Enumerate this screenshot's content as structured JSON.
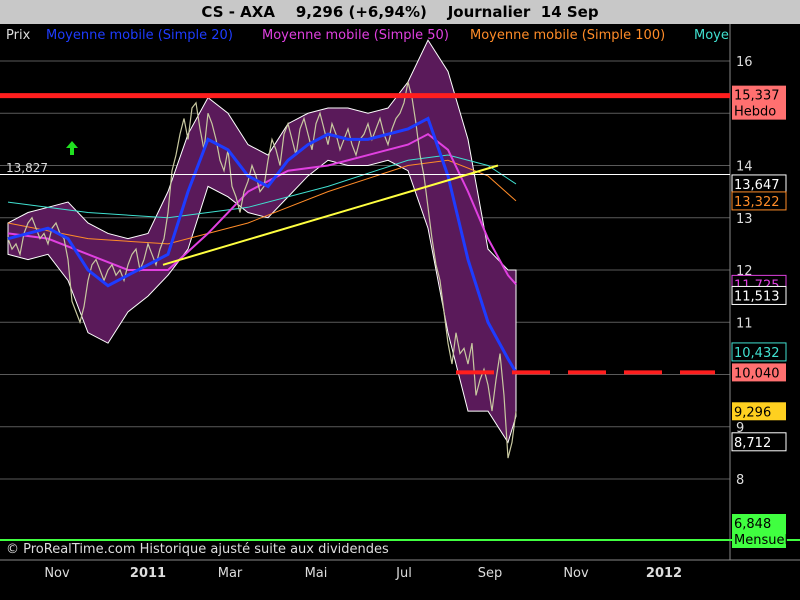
{
  "header": {
    "title": "CS - AXA    9,296 (+6,94%)    Journalier  14 Sep"
  },
  "colors": {
    "background": "#000000",
    "grid": "#5a5a5a",
    "price": "#c8c8a0",
    "envelope": "#5a1a5a",
    "ma20": "#1e3cff",
    "ma50": "#e040e0",
    "ma100": "#ff8c28",
    "ma200": "#40e0d0",
    "resistance": "#ff1e1e",
    "support_dashed": "#ff1e1e",
    "trendline": "#ffff40",
    "monthly_line": "#40ff40",
    "arrow": "#20e020"
  },
  "chart_data": {
    "type": "line",
    "title": "CS - AXA    9,296 (+6,94%)    Journalier  14 Sep",
    "legend": [
      "Prix",
      "Moyenne mobile (Simple 20)",
      "Moyenne mobile (Simple 50)",
      "Moyenne mobile (Simple 100)",
      "Moye"
    ],
    "legend_placement": "top",
    "y_ticks": [
      "16",
      "15",
      "14",
      "13",
      "12",
      "11",
      "10",
      "9",
      "8"
    ],
    "ylim": [
      6.6,
      16.5
    ],
    "x_ticks": [
      "Nov",
      "2011",
      "Mar",
      "Mai",
      "Jul",
      "Sep",
      "Nov",
      "2012"
    ],
    "grid": true,
    "series": [
      {
        "name": "Prix",
        "x": [
          0,
          4,
          8,
          12,
          16,
          20,
          24,
          28,
          32,
          36,
          40,
          44,
          48,
          52,
          56,
          60,
          64,
          68,
          72,
          76,
          80,
          84,
          88,
          92,
          96,
          100,
          104,
          108,
          112,
          116,
          120,
          124,
          128,
          132,
          136,
          140,
          144,
          148,
          152,
          156,
          160,
          164,
          168,
          172,
          176,
          180,
          184,
          188,
          192,
          196,
          200,
          204,
          208,
          212,
          216,
          220,
          224,
          228,
          232,
          236,
          240,
          244,
          248,
          252,
          256,
          260,
          264,
          268,
          272,
          276,
          280,
          284,
          288,
          292,
          296,
          300,
          304,
          308,
          312,
          316,
          320,
          324,
          328,
          332,
          336,
          340,
          344,
          348,
          352,
          356,
          360,
          364,
          368,
          372,
          376,
          380,
          384,
          388,
          392,
          396,
          400,
          404,
          408,
          412,
          416,
          420,
          424,
          428,
          432,
          436,
          440,
          444,
          448,
          452,
          456,
          460,
          464,
          468,
          472,
          476,
          480,
          484,
          488,
          492,
          496,
          500,
          504,
          508
        ],
        "y": [
          12.6,
          12.4,
          12.5,
          12.3,
          12.7,
          12.9,
          13.0,
          12.8,
          12.6,
          12.7,
          12.5,
          12.8,
          12.9,
          12.7,
          12.6,
          12.2,
          11.4,
          11.2,
          11.0,
          11.3,
          11.8,
          12.1,
          12.2,
          12.0,
          11.8,
          12.0,
          12.1,
          11.9,
          12.0,
          11.8,
          12.1,
          12.3,
          12.4,
          12.0,
          12.2,
          12.5,
          12.3,
          12.1,
          12.4,
          12.6,
          13.1,
          13.9,
          14.2,
          14.6,
          14.9,
          14.5,
          15.1,
          15.2,
          14.7,
          14.3,
          15.0,
          14.8,
          14.5,
          14.1,
          13.9,
          14.3,
          13.6,
          13.4,
          13.1,
          13.5,
          13.7,
          14.0,
          13.8,
          13.5,
          13.6,
          14.1,
          14.5,
          14.3,
          14.0,
          14.6,
          14.8,
          14.5,
          14.2,
          14.7,
          14.9,
          14.6,
          14.3,
          14.8,
          15.0,
          14.7,
          14.4,
          14.8,
          14.6,
          14.3,
          14.5,
          14.7,
          14.4,
          14.2,
          14.5,
          14.6,
          14.8,
          14.5,
          14.7,
          14.9,
          14.6,
          14.4,
          14.7,
          14.9,
          15.0,
          15.2,
          15.6,
          15.3,
          14.8,
          14.2,
          13.8,
          13.2,
          12.6,
          12.1,
          11.8,
          11.2,
          10.6,
          10.2,
          10.8,
          10.4,
          10.5,
          10.2,
          10.6,
          9.6,
          9.9,
          10.1,
          9.8,
          9.3,
          9.9,
          10.4,
          9.6,
          8.4,
          8.7,
          9.296
        ]
      },
      {
        "name": "Moyenne mobile (Simple 20)",
        "x": [
          0,
          20,
          40,
          60,
          80,
          100,
          120,
          140,
          160,
          180,
          200,
          220,
          240,
          260,
          280,
          300,
          320,
          340,
          360,
          380,
          400,
          420,
          440,
          460,
          480,
          500,
          508
        ],
        "y": [
          12.6,
          12.7,
          12.8,
          12.6,
          12.0,
          11.7,
          11.9,
          12.1,
          12.3,
          13.5,
          14.5,
          14.3,
          13.8,
          13.6,
          14.1,
          14.4,
          14.6,
          14.5,
          14.5,
          14.6,
          14.7,
          14.9,
          13.8,
          12.2,
          11.0,
          10.3,
          10.04
        ]
      },
      {
        "name": "Moyenne mobile (Simple 50)",
        "x": [
          0,
          40,
          80,
          120,
          160,
          200,
          220,
          240,
          280,
          320,
          360,
          400,
          420,
          440,
          460,
          480,
          500,
          508
        ],
        "y": [
          12.7,
          12.6,
          12.3,
          12.0,
          12.0,
          12.7,
          13.1,
          13.5,
          13.9,
          14.0,
          14.2,
          14.4,
          14.6,
          14.3,
          13.5,
          12.6,
          11.9,
          11.725
        ]
      },
      {
        "name": "Moyenne mobile (Simple 100)",
        "x": [
          0,
          80,
          160,
          240,
          320,
          400,
          440,
          480,
          508
        ],
        "y": [
          12.9,
          12.6,
          12.5,
          12.9,
          13.5,
          14.0,
          14.1,
          13.8,
          13.322
        ]
      },
      {
        "name": "Moye",
        "x": [
          0,
          80,
          160,
          240,
          320,
          400,
          440,
          480,
          508
        ],
        "y": [
          13.3,
          13.1,
          13.0,
          13.2,
          13.6,
          14.1,
          14.2,
          14.0,
          13.647
        ]
      }
    ],
    "envelope": {
      "x": [
        0,
        20,
        40,
        60,
        80,
        100,
        120,
        140,
        160,
        180,
        200,
        220,
        240,
        260,
        280,
        300,
        320,
        340,
        360,
        380,
        400,
        420,
        440,
        460,
        480,
        500,
        508
      ],
      "upper": [
        12.9,
        13.1,
        13.2,
        13.3,
        12.9,
        12.7,
        12.6,
        12.7,
        13.5,
        14.6,
        15.3,
        15.0,
        14.4,
        14.2,
        14.8,
        15.0,
        15.1,
        15.1,
        15.0,
        15.1,
        15.6,
        16.4,
        15.8,
        14.5,
        12.4,
        12.0,
        12.0
      ],
      "lower": [
        12.3,
        12.2,
        12.3,
        11.8,
        10.8,
        10.6,
        11.2,
        11.5,
        11.9,
        12.4,
        13.6,
        13.4,
        13.1,
        13.0,
        13.4,
        13.8,
        14.1,
        14.0,
        14.0,
        14.1,
        13.9,
        12.8,
        10.8,
        9.3,
        9.3,
        8.7,
        9.2
      ]
    },
    "trendline": {
      "x": [
        155,
        490
      ],
      "y": [
        12.1,
        14.0
      ]
    },
    "resistance": {
      "y": 15.337
    },
    "support": {
      "y": 10.04,
      "x_start": 448
    },
    "monthly_line": {
      "y": 6.848
    },
    "ref_13_827": {
      "y": 13.827
    },
    "ref_13_647": {
      "y": 13.647
    },
    "ref_11_513": {
      "y": 11.513
    }
  },
  "left_labels": {
    "prix": "Prix",
    "level_13827": "13,827"
  },
  "price_tags": [
    {
      "text": "15,337\nHebdo",
      "y": 15.337,
      "bg": "#ff7070",
      "fg": "#000000"
    },
    {
      "text": "13,647",
      "y": 13.647,
      "bg": "#000000",
      "fg": "#ffffff",
      "border": "#ffffff"
    },
    {
      "text": "13,322",
      "y": 13.322,
      "bg": "#000000",
      "fg": "#ff8c28",
      "border": "#ff8c28"
    },
    {
      "text": "11,725",
      "y": 11.725,
      "bg": "#000000",
      "fg": "#e040e0",
      "border": "#e040e0"
    },
    {
      "text": "11,513",
      "y": 11.513,
      "bg": "#000000",
      "fg": "#ffffff",
      "border": "#ffffff"
    },
    {
      "text": "10,432",
      "y": 10.432,
      "bg": "#000000",
      "fg": "#40e0d0",
      "border": "#40e0d0"
    },
    {
      "text": "10,040",
      "y": 10.04,
      "bg": "#ff7070",
      "fg": "#000000"
    },
    {
      "text": "9,296",
      "y": 9.296,
      "bg": "#ffd020",
      "fg": "#000000"
    },
    {
      "text": "8,712",
      "y": 8.712,
      "bg": "#000000",
      "fg": "#ffffff",
      "border": "#ffffff"
    },
    {
      "text": "6,848\nMensuel",
      "y": 6.848,
      "bg": "#40ff40",
      "fg": "#000000"
    }
  ],
  "footer": {
    "copyright": "© ProRealTime.com Historique ajusté suite aux dividendes"
  }
}
